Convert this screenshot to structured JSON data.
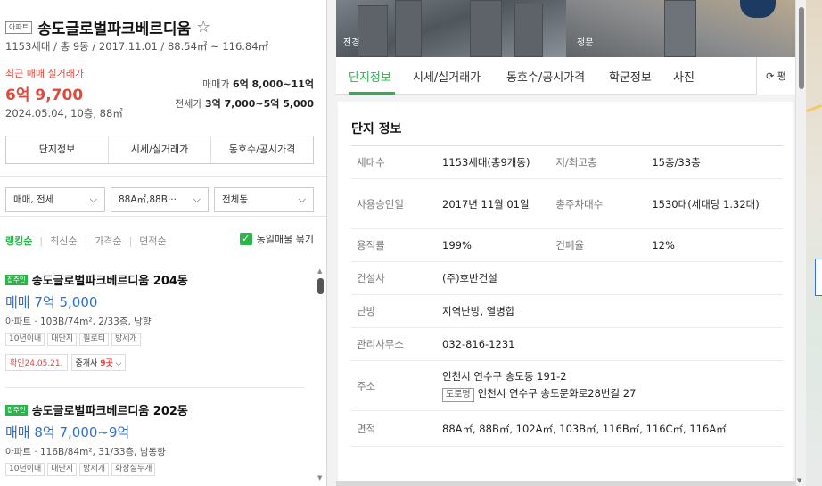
{
  "left": {
    "apt_badge": "아파트",
    "complex_name": "송도글로벌파크베르디움",
    "complex_sub": "1153세대 / 총 9동 / 2017.11.01 / 88.54㎡ ~ 116.84㎡",
    "recent_label": "최근 매매 실거래가",
    "recent_price": "6억 9,700",
    "recent_date": "2024.05.04, 10층, 88㎡",
    "sale_range_label": "매매가",
    "sale_range": "6억 8,000~11억",
    "jeonse_range_label": "전세가",
    "jeonse_range": "3억 7,000~5억 5,000",
    "tabs": [
      "단지정보",
      "시세/실거래가",
      "동호수/공시가격"
    ],
    "filters": {
      "trade": "매매, 전세",
      "area": "88A㎡,88B···",
      "dong": "전체동"
    },
    "sort": [
      "랭킹순",
      "최신순",
      "가격순",
      "면적순"
    ],
    "dedup_label": "동일매물 묶기",
    "listings": [
      {
        "tag": "집주인",
        "name": "송도글로벌파크베르디움 204동",
        "price": "매매 7억 5,000",
        "desc": "아파트 · 103B/74m², 2/33층, 남향",
        "chips": [
          "10년이내",
          "대단지",
          "필로티",
          "방세개"
        ],
        "confirm": "확인24.05.21.",
        "broker_prefix": "중개사 ",
        "broker_count": "9곳"
      },
      {
        "tag": "집주인",
        "name": "송도글로벌파크베르디움 202동",
        "price": "매매 8억 7,000~9억",
        "desc": "아파트 · 116B/84m², 31/33층, 남동향",
        "chips": [
          "10년이내",
          "대단지",
          "방세개",
          "화장실두개"
        ]
      }
    ]
  },
  "detail": {
    "photo_labels": [
      "전경",
      "정문"
    ],
    "tabs": [
      "단지정보",
      "시세/실거래가",
      "동호수/공시가격",
      "학군정보",
      "사진"
    ],
    "refresh_label": "평",
    "section_title": "단지 정보",
    "rows": {
      "households_label": "세대수",
      "households": "1153세대(총9개동)",
      "floors_label": "저/최고층",
      "floors": "15층/33층",
      "approval_label": "사용승인일",
      "approval": "2017년 11월 01일",
      "parking_label": "총주차대수",
      "parking": "1530대(세대당 1.32대)",
      "far_label": "용적률",
      "far": "199%",
      "bcr_label": "건폐율",
      "bcr": "12%",
      "builder_label": "건설사",
      "builder": "(주)호반건설",
      "heating_label": "난방",
      "heating": "지역난방, 열병합",
      "office_label": "관리사무소",
      "office": "032-816-1231",
      "address_label": "주소",
      "address": "인천시 연수구 송도동 191-2",
      "road_tag": "도로명",
      "road_address": "인천시 연수구 송도문화로28번길 27",
      "area_label": "면적",
      "area": "88A㎡, 88B㎡, 102A㎡, 103B㎡, 116B㎡, 116C㎡, 116A㎡"
    }
  }
}
